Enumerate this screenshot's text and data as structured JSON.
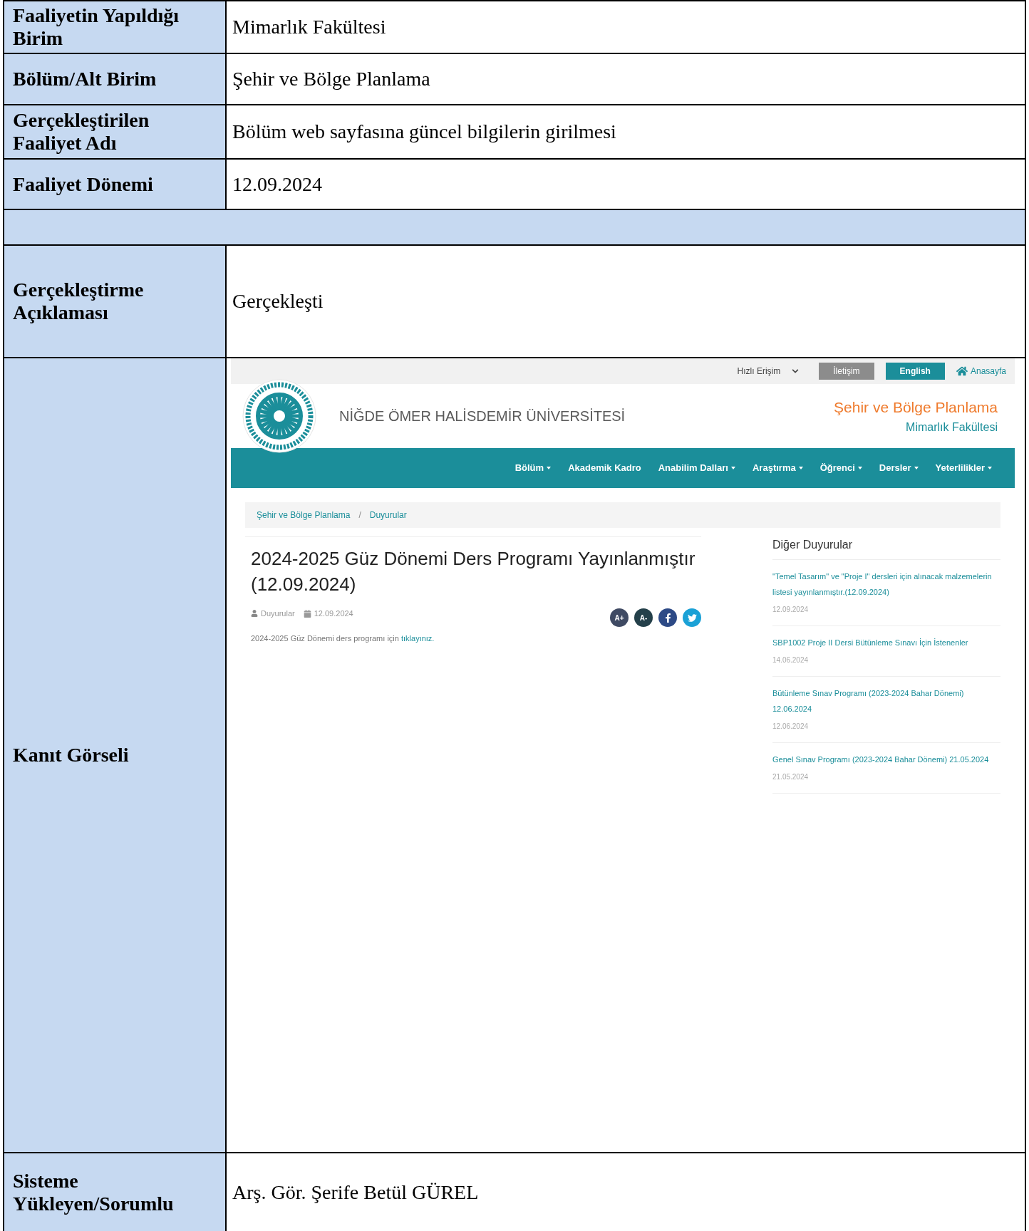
{
  "form": {
    "rows": [
      {
        "kind": "text",
        "label": "Faaliyetin Yapıldığı Birim",
        "value": "Mimarlık Fakültesi"
      },
      {
        "kind": "text",
        "label": "Bölüm/Alt Birim",
        "value": "Şehir ve Bölge Planlama"
      },
      {
        "kind": "text",
        "label": "Gerçekleştirilen Faaliyet Adı",
        "value": "Bölüm web sayfasına güncel bilgilerin girilmesi"
      },
      {
        "kind": "text",
        "label": "Faaliyet Dönemi",
        "value": "12.09.2024"
      },
      {
        "kind": "spacer"
      },
      {
        "kind": "text",
        "label": "Gerçekleştirme Açıklaması",
        "value": "Gerçekleşti"
      },
      {
        "kind": "evidence",
        "label": "Kanıt Görseli"
      },
      {
        "kind": "text",
        "label": "Sisteme Yükleyen/Sorumlu",
        "value": "Arş. Gör. Şerife Betül GÜREL"
      }
    ]
  },
  "website": {
    "top_bar": {
      "quick_access": "Hızlı Erişim",
      "contact_button": "İletişim",
      "english_button": "English",
      "home_link": "Anasayfa"
    },
    "university_name": "NİĞDE ÖMER HALİSDEMİR ÜNİVERSİTESİ",
    "department": "Şehir ve Bölge Planlama",
    "faculty": "Mimarlık Fakültesi",
    "nav": [
      {
        "label": "Bölüm",
        "has_menu": true
      },
      {
        "label": "Akademik Kadro",
        "has_menu": false
      },
      {
        "label": "Anabilim Dalları",
        "has_menu": true
      },
      {
        "label": "Araştırma",
        "has_menu": true
      },
      {
        "label": "Öğrenci",
        "has_menu": true
      },
      {
        "label": "Dersler",
        "has_menu": true
      },
      {
        "label": "Yeterlilikler",
        "has_menu": true
      }
    ],
    "breadcrumb": {
      "items": [
        "Şehir ve Bölge Planlama",
        "Duyurular"
      ],
      "separator": "/"
    },
    "article": {
      "title": "2024-2025 Güz Dönemi Ders Programı Yayınlanmıştır (12.09.2024)",
      "category": "Duyurular",
      "date": "12.09.2024",
      "font_increase": "A+",
      "font_decrease": "A-",
      "body": "2024-2025 Güz Dönemi ders programı için",
      "link": "tıklayınız."
    },
    "sidebar": {
      "title": "Diğer Duyurular",
      "items": [
        {
          "title": "\"Temel Tasarım\" ve \"Proje I\" dersleri için alınacak malzemelerin listesi yayınlanmıştır.(12.09.2024)",
          "date": "12.09.2024"
        },
        {
          "title": "SBP1002 Proje II Dersi Bütünleme Sınavı İçin İstenenler",
          "date": "14.06.2024"
        },
        {
          "title": "Bütünleme Sınav Programı (2023-2024 Bahar Dönemi) 12.06.2024",
          "date": "12.06.2024"
        },
        {
          "title": "Genel Sınav Programı (2023-2024 Bahar Dönemi) 21.05.2024",
          "date": "21.05.2024"
        }
      ]
    }
  }
}
